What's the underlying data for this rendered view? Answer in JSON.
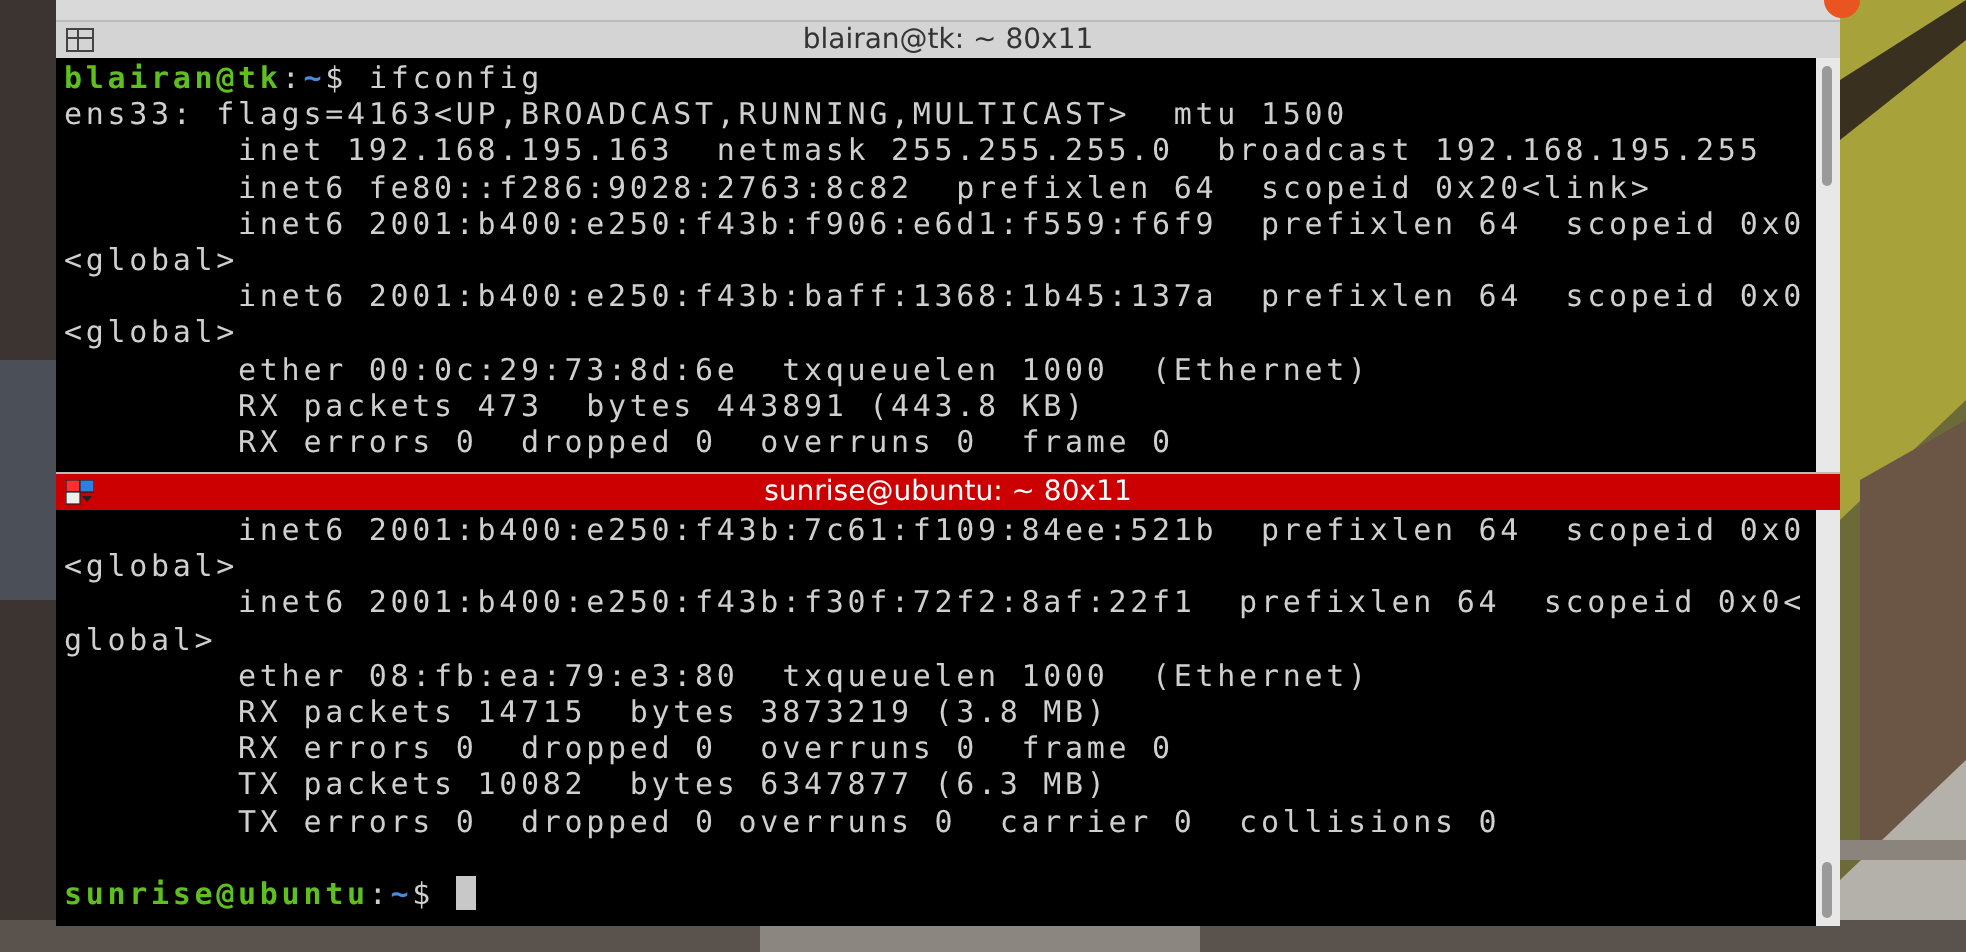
{
  "terminals": [
    {
      "title": "blairan@tk: ~ 80x11",
      "focused": false,
      "lines": [
        {
          "kind": "prompt",
          "user_host": "blairan@tk",
          "separator": ":",
          "path": "~",
          "symbol": "$",
          "command": "ifconfig",
          "cursor": false
        },
        {
          "kind": "output",
          "text": "ens33: flags=4163<UP,BROADCAST,RUNNING,MULTICAST>  mtu 1500"
        },
        {
          "kind": "output",
          "text": "        inet 192.168.195.163  netmask 255.255.255.0  broadcast 192.168.195.255"
        },
        {
          "kind": "output",
          "text": "        inet6 fe80::f286:9028:2763:8c82  prefixlen 64  scopeid 0x20<link>"
        },
        {
          "kind": "output",
          "text": "        inet6 2001:b400:e250:f43b:f906:e6d1:f559:f6f9  prefixlen 64  scopeid 0x0"
        },
        {
          "kind": "output",
          "text": "<global>"
        },
        {
          "kind": "output",
          "text": "        inet6 2001:b400:e250:f43b:baff:1368:1b45:137a  prefixlen 64  scopeid 0x0"
        },
        {
          "kind": "output",
          "text": "<global>"
        },
        {
          "kind": "output",
          "text": "        ether 00:0c:29:73:8d:6e  txqueuelen 1000  (Ethernet)"
        },
        {
          "kind": "output",
          "text": "        RX packets 473  bytes 443891 (443.8 KB)"
        },
        {
          "kind": "output",
          "text": "        RX errors 0  dropped 0  overruns 0  frame 0"
        }
      ]
    },
    {
      "title": "sunrise@ubuntu: ~ 80x11",
      "focused": true,
      "lines": [
        {
          "kind": "output",
          "text": "        inet6 2001:b400:e250:f43b:7c61:f109:84ee:521b  prefixlen 64  scopeid 0x0"
        },
        {
          "kind": "output",
          "text": "<global>"
        },
        {
          "kind": "output",
          "text": "        inet6 2001:b400:e250:f43b:f30f:72f2:8af:22f1  prefixlen 64  scopeid 0x0<"
        },
        {
          "kind": "output",
          "text": "global>"
        },
        {
          "kind": "output",
          "text": "        ether 08:fb:ea:79:e3:80  txqueuelen 1000  (Ethernet)"
        },
        {
          "kind": "output",
          "text": "        RX packets 14715  bytes 3873219 (3.8 MB)"
        },
        {
          "kind": "output",
          "text": "        RX errors 0  dropped 0  overruns 0  frame 0"
        },
        {
          "kind": "output",
          "text": "        TX packets 10082  bytes 6347877 (6.3 MB)"
        },
        {
          "kind": "output",
          "text": "        TX errors 0  dropped 0 overruns 0  carrier 0  collisions 0"
        },
        {
          "kind": "blank"
        },
        {
          "kind": "prompt",
          "user_host": "sunrise@ubuntu",
          "separator": ":",
          "path": "~",
          "symbol": "$",
          "cursor": true
        }
      ]
    }
  ]
}
